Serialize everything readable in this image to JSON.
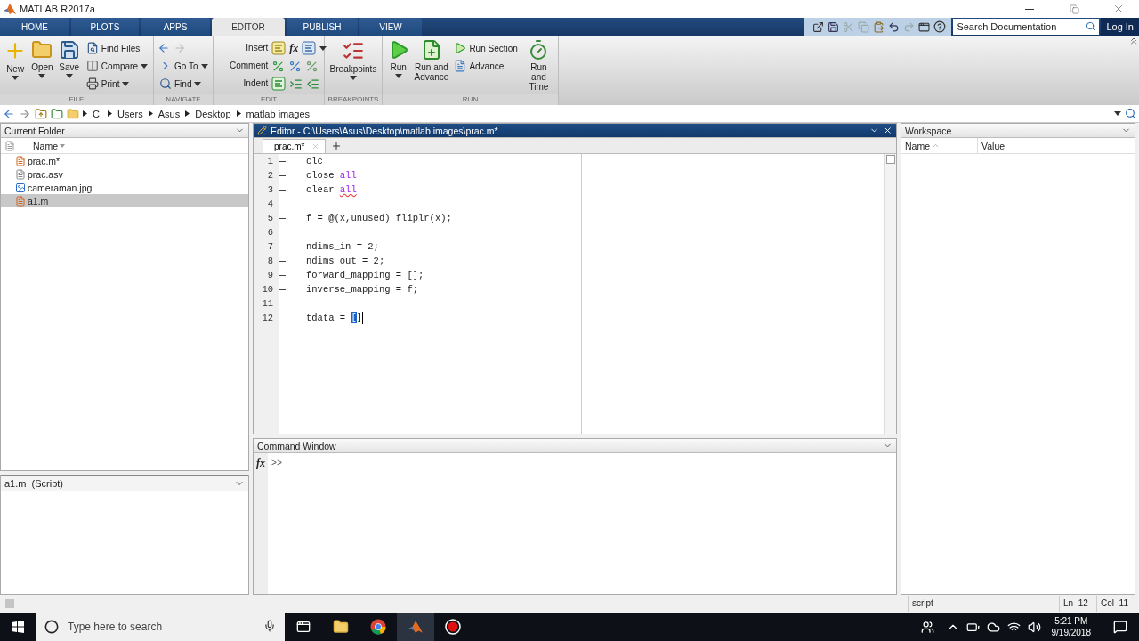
{
  "window": {
    "title": "MATLAB R2017a"
  },
  "tabs": [
    {
      "label": "HOME",
      "selected": false
    },
    {
      "label": "PLOTS",
      "selected": false
    },
    {
      "label": "APPS",
      "selected": false
    },
    {
      "label": "EDITOR",
      "selected": true
    },
    {
      "label": "PUBLISH",
      "selected": false
    },
    {
      "label": "VIEW",
      "selected": false
    }
  ],
  "search": {
    "placeholder": "Search Documentation"
  },
  "login": "Log In",
  "ribbon": {
    "file": {
      "label": "FILE",
      "new": "New",
      "open": "Open",
      "save": "Save",
      "find_files": "Find Files",
      "compare": "Compare",
      "print": "Print"
    },
    "navigate": {
      "label": "NAVIGATE",
      "go_to": "Go To",
      "find": "Find"
    },
    "edit": {
      "label": "EDIT",
      "insert": "Insert",
      "function_glyph": "fx",
      "comment": "Comment",
      "indent": "Indent"
    },
    "breakpoints": {
      "label": "BREAKPOINTS",
      "breakpoints": "Breakpoints"
    },
    "run": {
      "label": "RUN",
      "run": "Run",
      "run_and_advance": "Run and Advance",
      "run_section": "Run Section",
      "advance": "Advance",
      "run_and_time": "Run and Time"
    }
  },
  "address": {
    "path": [
      "C:",
      "Users",
      "Asus",
      "Desktop",
      "matlab images"
    ]
  },
  "current_folder": {
    "title": "Current Folder",
    "column": "Name",
    "files": [
      {
        "name": "prac.m*",
        "kind": "script",
        "selected": false
      },
      {
        "name": "prac.asv",
        "kind": "text",
        "selected": false
      },
      {
        "name": "cameraman.jpg",
        "kind": "image",
        "selected": false
      },
      {
        "name": "a1.m",
        "kind": "script",
        "selected": true
      }
    ],
    "details": "a1.m  (Script)"
  },
  "editor": {
    "title": "Editor - C:\\Users\\Asus\\Desktop\\matlab images\\prac.m*",
    "tabs": [
      {
        "label": "prac.m*",
        "selected": true
      }
    ],
    "lines": [
      {
        "number": "1",
        "executable": true,
        "tokens": [
          {
            "text": "clc",
            "kind": "plain"
          }
        ]
      },
      {
        "number": "2",
        "executable": true,
        "tokens": [
          {
            "text": "close ",
            "kind": "plain"
          },
          {
            "text": "all",
            "kind": "string"
          }
        ]
      },
      {
        "number": "3",
        "executable": true,
        "tokens": [
          {
            "text": "clear ",
            "kind": "plain"
          },
          {
            "text": "all",
            "kind": "string",
            "warning": true
          }
        ]
      },
      {
        "number": "4",
        "executable": false
      },
      {
        "number": "5",
        "executable": true,
        "tokens": [
          {
            "text": "f = @(x,unused) fliplr(x);",
            "kind": "plain"
          }
        ]
      },
      {
        "number": "6",
        "executable": false
      },
      {
        "number": "7",
        "executable": true,
        "tokens": [
          {
            "text": "ndims_in = 2;",
            "kind": "plain"
          }
        ]
      },
      {
        "number": "8",
        "executable": true,
        "tokens": [
          {
            "text": "ndims_out = 2;",
            "kind": "plain"
          }
        ]
      },
      {
        "number": "9",
        "executable": true,
        "tokens": [
          {
            "text": "forward_mapping = [];",
            "kind": "plain"
          }
        ]
      },
      {
        "number": "10",
        "executable": true,
        "tokens": [
          {
            "text": "inverse_mapping = f;",
            "kind": "plain"
          }
        ]
      },
      {
        "number": "11",
        "executable": false
      },
      {
        "number": "12",
        "executable": false,
        "tokens": [
          {
            "text": "tdata = ",
            "kind": "plain"
          },
          {
            "text": "[",
            "kind": "plain",
            "selected": true
          },
          {
            "text": "]",
            "kind": "plain"
          }
        ]
      }
    ]
  },
  "command_window": {
    "title": "Command Window",
    "function_glyph": "fx",
    "prompt": ">>"
  },
  "workspace": {
    "title": "Workspace",
    "columns": [
      "Name",
      "Value"
    ]
  },
  "status_bar": {
    "mode": "script",
    "line": "Ln  12",
    "column": "Col  11"
  },
  "taskbar": {
    "search_placeholder": "Type here to search",
    "time": "5:21 PM",
    "date": "9/19/2018"
  }
}
